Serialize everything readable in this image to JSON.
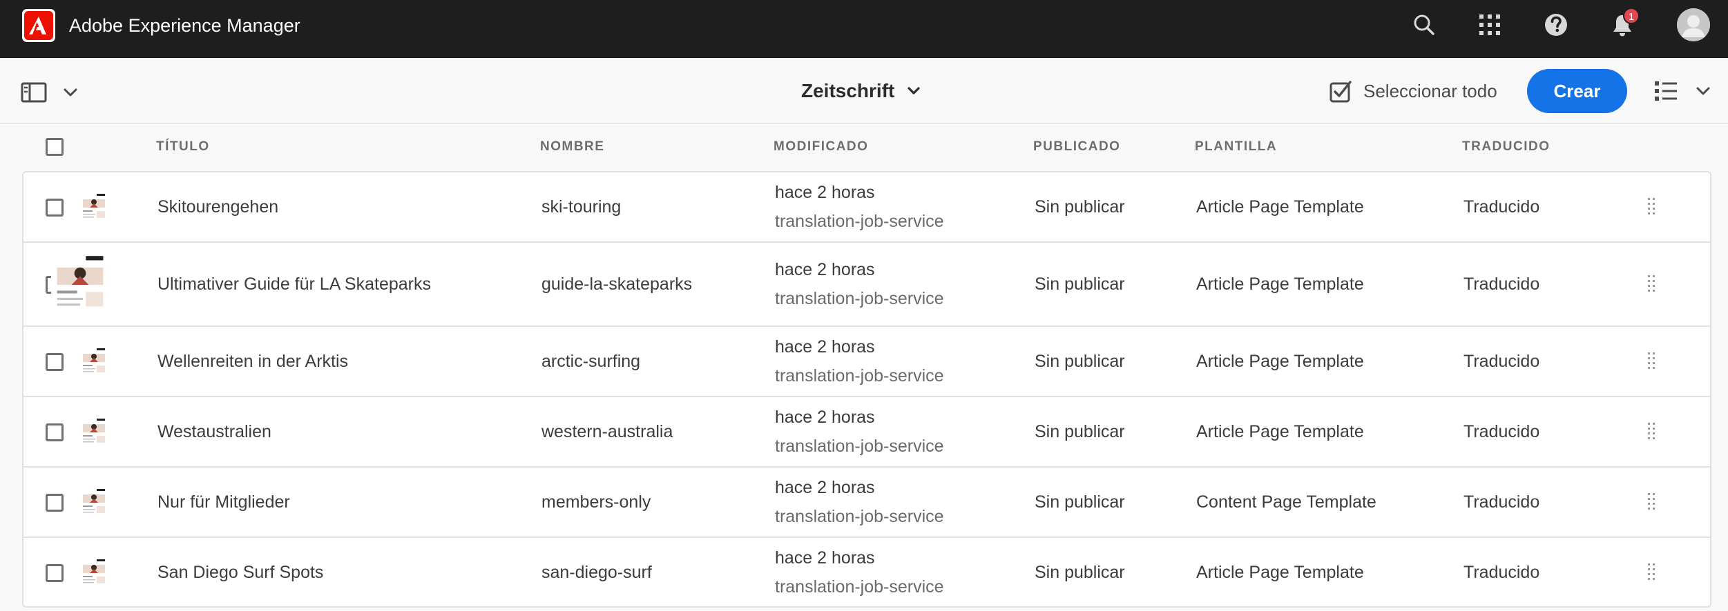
{
  "shell": {
    "app_title": "Adobe Experience Manager",
    "notification_count": "1",
    "icons": [
      "adobe-logo",
      "search-icon",
      "apps-grid-icon",
      "help-icon",
      "bell-icon",
      "user-avatar"
    ]
  },
  "actionbar": {
    "folder_title": "Zeitschrift",
    "select_all_label": "Seleccionar todo",
    "create_label": "Crear"
  },
  "table": {
    "headers": {
      "title": "TÍTULO",
      "name": "NOMBRE",
      "modified": "MODIFICADO",
      "published": "PUBLICADO",
      "template": "PLANTILLA",
      "translated": "TRADUCIDO"
    },
    "rows": [
      {
        "title": "Skitourengehen",
        "name": "ski-touring",
        "modified": "hace 2 horas",
        "modified_by": "translation-job-service",
        "published": "Sin publicar",
        "template": "Article Page Template",
        "translated": "Traducido"
      },
      {
        "title": "Ultimativer Guide für LA Skateparks",
        "name": "guide-la-skateparks",
        "modified": "hace 2 horas",
        "modified_by": "translation-job-service",
        "published": "Sin publicar",
        "template": "Article Page Template",
        "translated": "Traducido"
      },
      {
        "title": "Wellenreiten in der Arktis",
        "name": "arctic-surfing",
        "modified": "hace 2 horas",
        "modified_by": "translation-job-service",
        "published": "Sin publicar",
        "template": "Article Page Template",
        "translated": "Traducido"
      },
      {
        "title": "Westaustralien",
        "name": "western-australia",
        "modified": "hace 2 horas",
        "modified_by": "translation-job-service",
        "published": "Sin publicar",
        "template": "Article Page Template",
        "translated": "Traducido"
      },
      {
        "title": "Nur für Mitglieder",
        "name": "members-only",
        "modified": "hace 2 horas",
        "modified_by": "translation-job-service",
        "published": "Sin publicar",
        "template": "Content Page Template",
        "translated": "Traducido"
      },
      {
        "title": "San Diego Surf Spots",
        "name": "san-diego-surf",
        "modified": "hace 2 horas",
        "modified_by": "translation-job-service",
        "published": "Sin publicar",
        "template": "Article Page Template",
        "translated": "Traducido"
      }
    ]
  },
  "colors": {
    "shell_bg": "#1e1e1e",
    "accent": "#1473e6",
    "brand_red": "#eb1000",
    "badge_red": "#e34850"
  }
}
